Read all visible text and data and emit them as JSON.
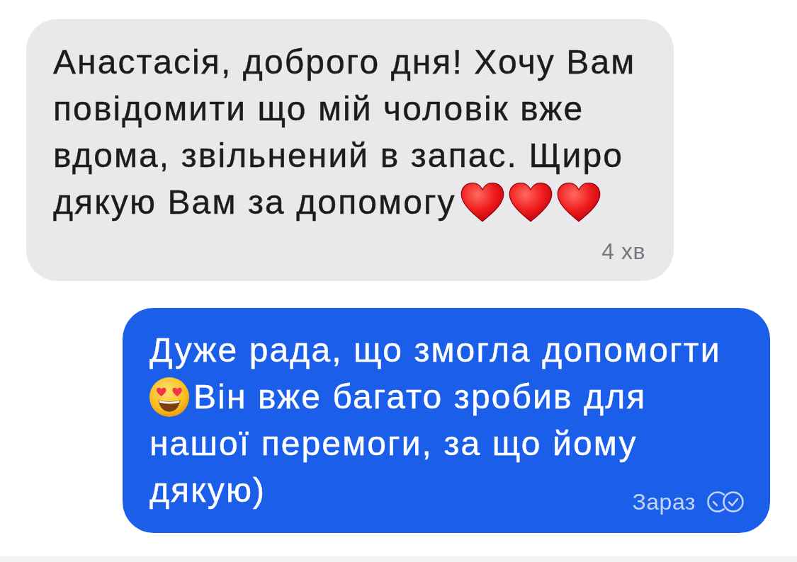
{
  "messages": [
    {
      "kind": "incoming",
      "parts": [
        {
          "kind": "text",
          "text": "Анастасія, доброго дня! Хочу Вам повідомити що мій чоловік вже вдома, звільнений в запас. Щиро дякую Вам за допомогу"
        },
        {
          "kind": "heart"
        },
        {
          "kind": "heart"
        },
        {
          "kind": "heart"
        }
      ],
      "time": "4 хв"
    },
    {
      "kind": "outgoing",
      "parts": [
        {
          "kind": "text",
          "text": "Дуже рада, що змогла допомогти"
        },
        {
          "kind": "hearteyes"
        },
        {
          "kind": "text",
          "text": "Він вже багато зробив для нашої перемоги, за що йому дякую)"
        }
      ],
      "time": "Зараз",
      "read": true
    }
  ]
}
